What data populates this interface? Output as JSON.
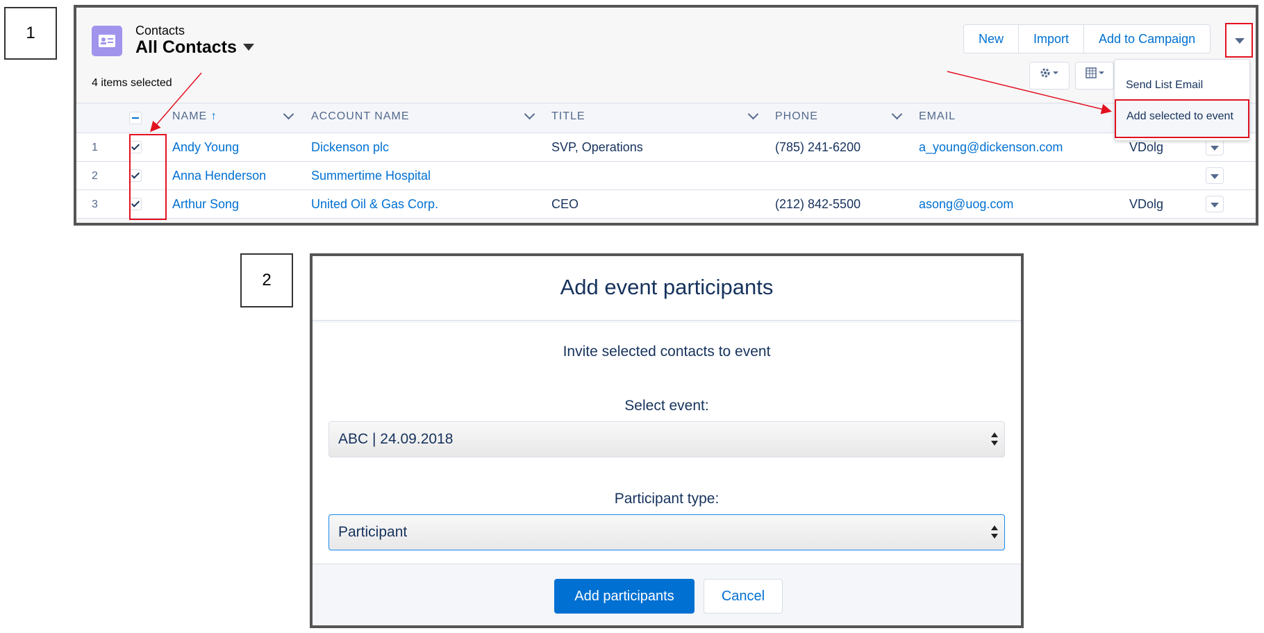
{
  "labels": {
    "step1": "1",
    "step2": "2"
  },
  "list_view": {
    "object_name": "Contacts",
    "view_name": "All Contacts",
    "selection_status": "4 items selected",
    "buttons": [
      "New",
      "Import",
      "Add to Campaign"
    ],
    "dropdown_items": [
      "Send List Email",
      "Add selected to event"
    ],
    "columns": [
      "NAME",
      "ACCOUNT NAME",
      "TITLE",
      "PHONE",
      "EMAIL"
    ],
    "sort_indicator": "↑",
    "rows": [
      {
        "num": "1",
        "name": "Andy Young",
        "account": "Dickenson plc",
        "title": "SVP, Operations",
        "phone": "(785) 241-6200",
        "email": "a_young@dickenson.com",
        "owner": "VDolg"
      },
      {
        "num": "2",
        "name": "Anna Henderson",
        "account": "Summertime Hospital",
        "title": "",
        "phone": "",
        "email": "",
        "owner": ""
      },
      {
        "num": "3",
        "name": "Arthur Song",
        "account": "United Oil & Gas Corp.",
        "title": "CEO",
        "phone": "(212) 842-5500",
        "email": "asong@uog.com",
        "owner": "VDolg"
      }
    ],
    "icons": {
      "object": "contact-card-icon",
      "settings": "gear-icon",
      "display": "table-icon"
    }
  },
  "modal": {
    "title": "Add event participants",
    "subtitle": "Invite selected contacts to event",
    "event_label": "Select event:",
    "event_value": "ABC | 24.09.2018",
    "type_label": "Participant type:",
    "type_value": "Participant",
    "primary_button": "Add participants",
    "cancel_button": "Cancel"
  },
  "colors": {
    "brand": "#0070d2",
    "highlight": "#e3101f",
    "text": "#16325c"
  }
}
